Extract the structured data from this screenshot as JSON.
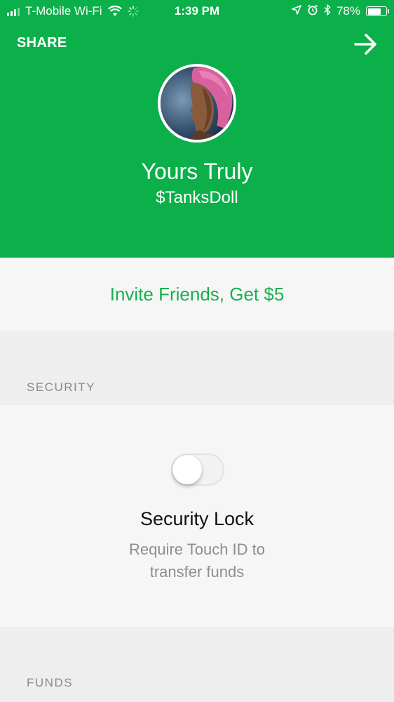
{
  "status_bar": {
    "carrier": "T-Mobile Wi-Fi",
    "time": "1:39 PM",
    "battery_percent": "78%",
    "battery_level": 0.78,
    "icons": [
      "signal-icon",
      "wifi-icon",
      "activity-spinner-icon",
      "location-arrow-icon",
      "alarm-icon",
      "bluetooth-icon",
      "battery-icon"
    ]
  },
  "header": {
    "share_label": "SHARE",
    "forward_icon": "arrow-right-icon",
    "display_name": "Yours Truly",
    "cashtag": "$TanksDoll",
    "background_color": "#0bb04a"
  },
  "invite": {
    "label": "Invite Friends, Get $5",
    "color": "#16b14e"
  },
  "sections": {
    "security_title": "SECURITY",
    "funds_title": "FUNDS"
  },
  "security_lock": {
    "title": "Security Lock",
    "description_line1": "Require Touch ID to",
    "description_line2": "transfer funds",
    "enabled": false
  }
}
